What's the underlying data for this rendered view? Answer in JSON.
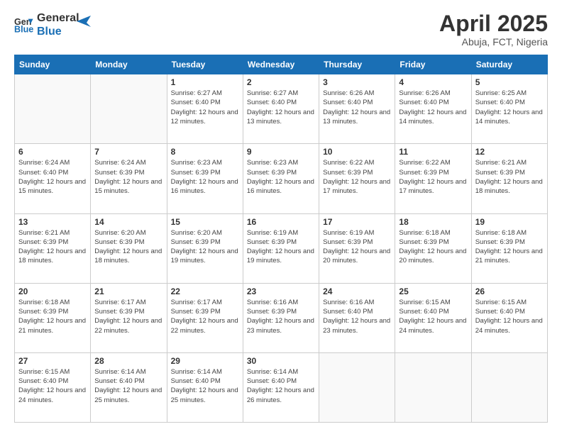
{
  "header": {
    "logo_line1": "General",
    "logo_line2": "Blue",
    "title": "April 2025",
    "subtitle": "Abuja, FCT, Nigeria"
  },
  "weekdays": [
    "Sunday",
    "Monday",
    "Tuesday",
    "Wednesday",
    "Thursday",
    "Friday",
    "Saturday"
  ],
  "weeks": [
    [
      {
        "day": "",
        "info": ""
      },
      {
        "day": "",
        "info": ""
      },
      {
        "day": "1",
        "info": "Sunrise: 6:27 AM\nSunset: 6:40 PM\nDaylight: 12 hours and 12 minutes."
      },
      {
        "day": "2",
        "info": "Sunrise: 6:27 AM\nSunset: 6:40 PM\nDaylight: 12 hours and 13 minutes."
      },
      {
        "day": "3",
        "info": "Sunrise: 6:26 AM\nSunset: 6:40 PM\nDaylight: 12 hours and 13 minutes."
      },
      {
        "day": "4",
        "info": "Sunrise: 6:26 AM\nSunset: 6:40 PM\nDaylight: 12 hours and 14 minutes."
      },
      {
        "day": "5",
        "info": "Sunrise: 6:25 AM\nSunset: 6:40 PM\nDaylight: 12 hours and 14 minutes."
      }
    ],
    [
      {
        "day": "6",
        "info": "Sunrise: 6:24 AM\nSunset: 6:40 PM\nDaylight: 12 hours and 15 minutes."
      },
      {
        "day": "7",
        "info": "Sunrise: 6:24 AM\nSunset: 6:39 PM\nDaylight: 12 hours and 15 minutes."
      },
      {
        "day": "8",
        "info": "Sunrise: 6:23 AM\nSunset: 6:39 PM\nDaylight: 12 hours and 16 minutes."
      },
      {
        "day": "9",
        "info": "Sunrise: 6:23 AM\nSunset: 6:39 PM\nDaylight: 12 hours and 16 minutes."
      },
      {
        "day": "10",
        "info": "Sunrise: 6:22 AM\nSunset: 6:39 PM\nDaylight: 12 hours and 17 minutes."
      },
      {
        "day": "11",
        "info": "Sunrise: 6:22 AM\nSunset: 6:39 PM\nDaylight: 12 hours and 17 minutes."
      },
      {
        "day": "12",
        "info": "Sunrise: 6:21 AM\nSunset: 6:39 PM\nDaylight: 12 hours and 18 minutes."
      }
    ],
    [
      {
        "day": "13",
        "info": "Sunrise: 6:21 AM\nSunset: 6:39 PM\nDaylight: 12 hours and 18 minutes."
      },
      {
        "day": "14",
        "info": "Sunrise: 6:20 AM\nSunset: 6:39 PM\nDaylight: 12 hours and 18 minutes."
      },
      {
        "day": "15",
        "info": "Sunrise: 6:20 AM\nSunset: 6:39 PM\nDaylight: 12 hours and 19 minutes."
      },
      {
        "day": "16",
        "info": "Sunrise: 6:19 AM\nSunset: 6:39 PM\nDaylight: 12 hours and 19 minutes."
      },
      {
        "day": "17",
        "info": "Sunrise: 6:19 AM\nSunset: 6:39 PM\nDaylight: 12 hours and 20 minutes."
      },
      {
        "day": "18",
        "info": "Sunrise: 6:18 AM\nSunset: 6:39 PM\nDaylight: 12 hours and 20 minutes."
      },
      {
        "day": "19",
        "info": "Sunrise: 6:18 AM\nSunset: 6:39 PM\nDaylight: 12 hours and 21 minutes."
      }
    ],
    [
      {
        "day": "20",
        "info": "Sunrise: 6:18 AM\nSunset: 6:39 PM\nDaylight: 12 hours and 21 minutes."
      },
      {
        "day": "21",
        "info": "Sunrise: 6:17 AM\nSunset: 6:39 PM\nDaylight: 12 hours and 22 minutes."
      },
      {
        "day": "22",
        "info": "Sunrise: 6:17 AM\nSunset: 6:39 PM\nDaylight: 12 hours and 22 minutes."
      },
      {
        "day": "23",
        "info": "Sunrise: 6:16 AM\nSunset: 6:39 PM\nDaylight: 12 hours and 23 minutes."
      },
      {
        "day": "24",
        "info": "Sunrise: 6:16 AM\nSunset: 6:40 PM\nDaylight: 12 hours and 23 minutes."
      },
      {
        "day": "25",
        "info": "Sunrise: 6:15 AM\nSunset: 6:40 PM\nDaylight: 12 hours and 24 minutes."
      },
      {
        "day": "26",
        "info": "Sunrise: 6:15 AM\nSunset: 6:40 PM\nDaylight: 12 hours and 24 minutes."
      }
    ],
    [
      {
        "day": "27",
        "info": "Sunrise: 6:15 AM\nSunset: 6:40 PM\nDaylight: 12 hours and 24 minutes."
      },
      {
        "day": "28",
        "info": "Sunrise: 6:14 AM\nSunset: 6:40 PM\nDaylight: 12 hours and 25 minutes."
      },
      {
        "day": "29",
        "info": "Sunrise: 6:14 AM\nSunset: 6:40 PM\nDaylight: 12 hours and 25 minutes."
      },
      {
        "day": "30",
        "info": "Sunrise: 6:14 AM\nSunset: 6:40 PM\nDaylight: 12 hours and 26 minutes."
      },
      {
        "day": "",
        "info": ""
      },
      {
        "day": "",
        "info": ""
      },
      {
        "day": "",
        "info": ""
      }
    ]
  ]
}
